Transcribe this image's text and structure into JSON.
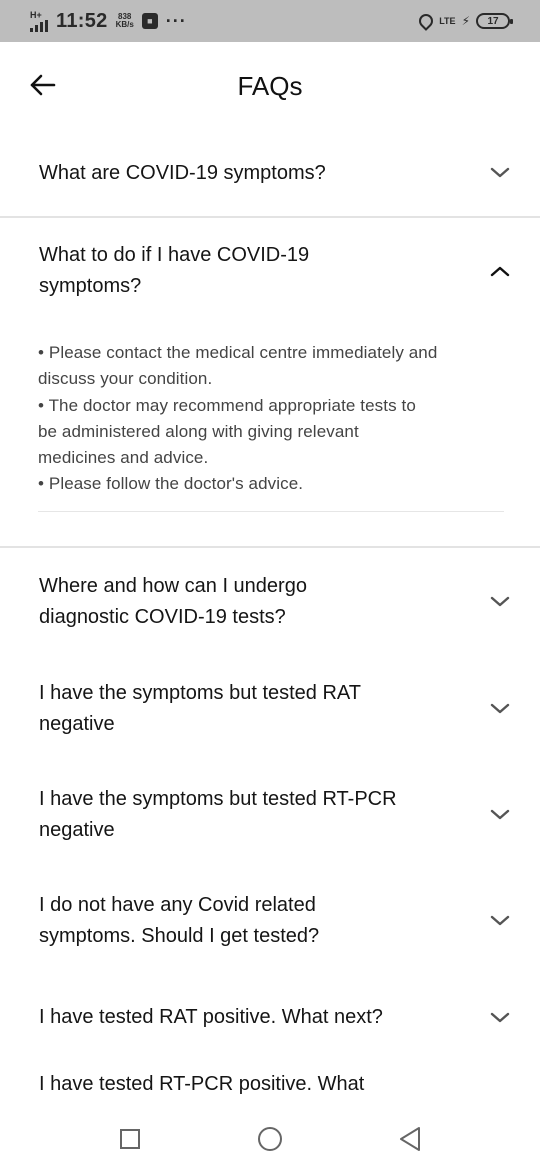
{
  "status_bar": {
    "network": "H+",
    "time": "11:52",
    "speed_value": "838",
    "speed_unit": "KB/s",
    "more": "···",
    "network_right": "LTE",
    "battery": "17"
  },
  "header": {
    "title": "FAQs",
    "back_icon": "arrow-left-icon"
  },
  "faqs": [
    {
      "question": [
        "What are COVID-19 symptoms?"
      ],
      "expanded": false
    },
    {
      "question": [
        "What to do if I have COVID-19",
        "symptoms?"
      ],
      "expanded": true,
      "answer_lines": [
        "• Please contact the medical centre immediately and",
        "discuss your condition.",
        "• The doctor may recommend appropriate tests to",
        "be administered along with giving relevant",
        "medicines and advice.",
        "• Please follow the doctor's advice."
      ]
    },
    {
      "question": [
        "Where and how can I undergo",
        "diagnostic COVID-19 tests?"
      ],
      "expanded": false
    },
    {
      "question": [
        "I have the symptoms but tested RAT",
        "negative"
      ],
      "expanded": false
    },
    {
      "question": [
        "I have the symptoms but tested RT-PCR",
        "negative"
      ],
      "expanded": false
    },
    {
      "question": [
        "I do not have any Covid related",
        "symptoms. Should I get tested?"
      ],
      "expanded": false
    },
    {
      "question": [
        "I have tested RAT positive. What next?"
      ],
      "expanded": false
    },
    {
      "question": [
        "I have tested RT-PCR positive. What"
      ],
      "expanded": false
    }
  ],
  "nav_bar": {
    "recents_icon": "square-icon",
    "home_icon": "circle-icon",
    "back_icon": "triangle-back-icon"
  },
  "colors": {
    "status_bar_bg": "#bdbdbd",
    "text": "#151515",
    "answer_text": "#444444",
    "divider": "#e3e3e3",
    "chevron": "#555555"
  }
}
